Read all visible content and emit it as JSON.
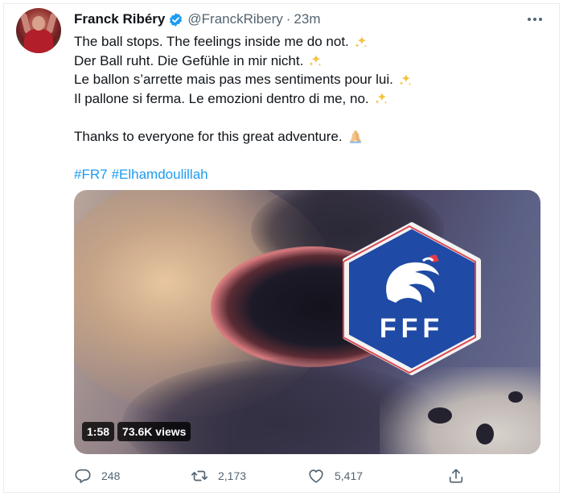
{
  "tweet": {
    "author_name": "Franck Ribéry",
    "handle": "@FranckRibery",
    "separator": "·",
    "time": "23m",
    "lines": [
      "The ball stops. The feelings inside me do not.",
      "Der Ball ruht. Die Gefühle in mir nicht.",
      "Le ballon s’arrette mais pas mes sentiments pour lui.",
      "Il pallone si ferma. Le emozioni dentro di me, no."
    ],
    "thanks": "Thanks to everyone for this great adventure.",
    "hashtags": [
      "#FR7",
      "#Elhamdoulillah"
    ]
  },
  "media": {
    "logo_text": "FFF",
    "duration": "1:58",
    "views": "73.6K views"
  },
  "actions": {
    "reply_count": "248",
    "retweet_count": "2,173",
    "like_count": "5,417"
  },
  "colors": {
    "link": "#1d9bf0",
    "muted": "#536471",
    "verified": "#1d9bf0",
    "sparkle": "#f5c33b",
    "fff_blue": "#1f4aa5"
  },
  "icons": [
    "verified-badge-icon",
    "more-options-icon",
    "sparkles-icon",
    "folded-hands-icon",
    "reply-icon",
    "retweet-icon",
    "like-icon",
    "share-icon"
  ]
}
